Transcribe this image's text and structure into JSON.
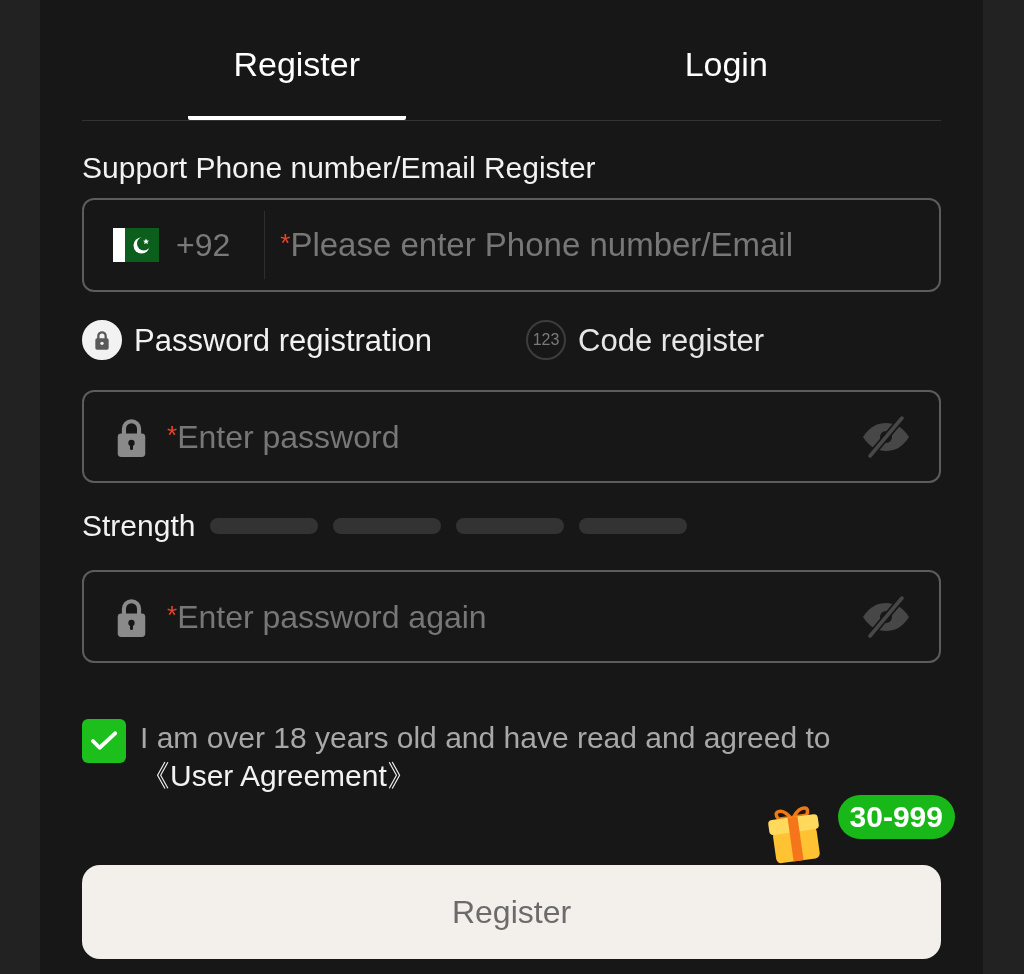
{
  "tabs": [
    {
      "label": "Register",
      "selected": true
    },
    {
      "label": "Login",
      "selected": false
    }
  ],
  "account": {
    "label": "Support Phone number/Email Register",
    "country_code": "+92",
    "required_mark": "*",
    "placeholder": "Please enter Phone number/Email"
  },
  "methods": [
    {
      "kind": "password",
      "label": "Password registration",
      "selected": true
    },
    {
      "kind": "code",
      "icon_text": "123",
      "label": "Code register",
      "selected": false
    }
  ],
  "password": {
    "required_mark": "*",
    "placeholder": "Enter password"
  },
  "strength": {
    "label": "Strength"
  },
  "confirm_password": {
    "required_mark": "*",
    "placeholder": "Enter password again"
  },
  "agreement": {
    "checked": true,
    "text": "I am over 18 years old and have read and agreed to",
    "link": "《User Agreement》"
  },
  "bonus_badge": {
    "text": "30-999"
  },
  "submit": {
    "label": "Register",
    "disabled": true
  }
}
